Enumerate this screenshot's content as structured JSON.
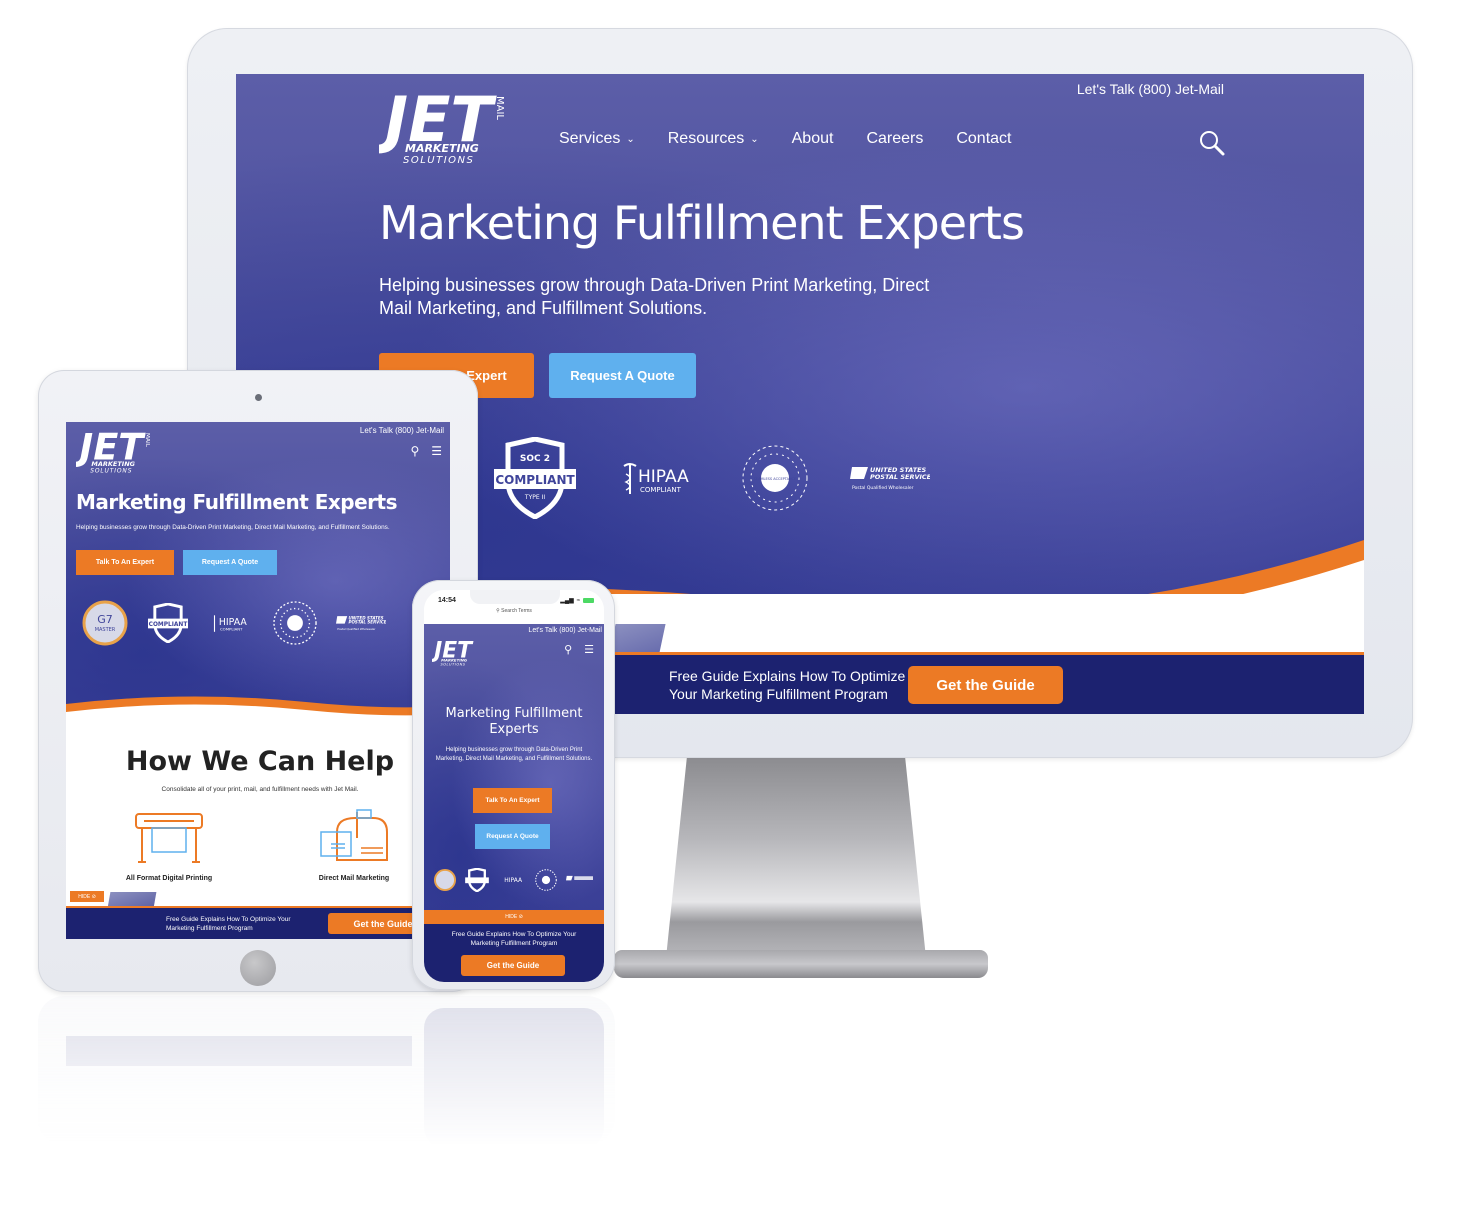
{
  "brand": {
    "logo_main": "JET",
    "logo_side": "MAIL",
    "logo_line1": "MARKETING",
    "logo_line2": "SOLUTIONS"
  },
  "topbar": {
    "phone": "Let's Talk (800)  Jet-Mail"
  },
  "nav": {
    "items": [
      {
        "label": "Services",
        "dropdown": true
      },
      {
        "label": "Resources",
        "dropdown": true
      },
      {
        "label": "About",
        "dropdown": false
      },
      {
        "label": "Careers",
        "dropdown": false
      },
      {
        "label": "Contact",
        "dropdown": false
      }
    ],
    "search_icon": "search-icon",
    "menu_icon": "hamburger-menu-icon"
  },
  "hero": {
    "title": "Marketing Fulfillment Experts",
    "title_mobile_line1": "Marketing Fulfillment",
    "title_mobile_line2": "Experts",
    "subtitle": "Helping businesses grow through Data-Driven Print Marketing, Direct Mail Marketing, and Fulfillment Solutions.",
    "cta_primary": "Talk To An Expert",
    "cta_primary_visible_desktop": "Expert",
    "cta_secondary": "Request A Quote"
  },
  "badges": {
    "g7": {
      "line1": "G7",
      "line2": "MASTER"
    },
    "soc2": {
      "top": "SOC 2",
      "main": "COMPLIANT",
      "bottom": "TYPE II"
    },
    "hipaa": {
      "main": "HIPAA",
      "sub": "COMPLIANT"
    },
    "seamless": {
      "text": "SEAMLESS ACCEPTANCE"
    },
    "usps": {
      "line1": "UNITED STATES",
      "line2": "POSTAL SERVICE",
      "sub": "Postal Qualified Wholesaler"
    }
  },
  "help": {
    "title": "How We Can Help",
    "subtitle": "Consolidate all of your print, mail, and fulfillment needs with Jet Mail.",
    "services": [
      {
        "label": "All Format Digital Printing",
        "icon": "printer-icon"
      },
      {
        "label": "Direct Mail Marketing",
        "icon": "mailbox-icon"
      }
    ]
  },
  "guide_banner": {
    "text_line1": "Free Guide Explains How To Optimize",
    "text_line2": "Your Marketing Fulfillment Program",
    "text_tablet_line1": "Free Guide Explains How To Optimize Your",
    "text_tablet_line2": "Marketing Fulfillment Program",
    "button": "Get the Guide",
    "hide_label": "HIDE"
  },
  "phone_status": {
    "time": "14:54",
    "url": "Search Terms"
  },
  "colors": {
    "orange": "#ec7a25",
    "light_blue": "#5fb0ee",
    "navy": "#1c2270",
    "hero_purple": "#4f52a0"
  }
}
